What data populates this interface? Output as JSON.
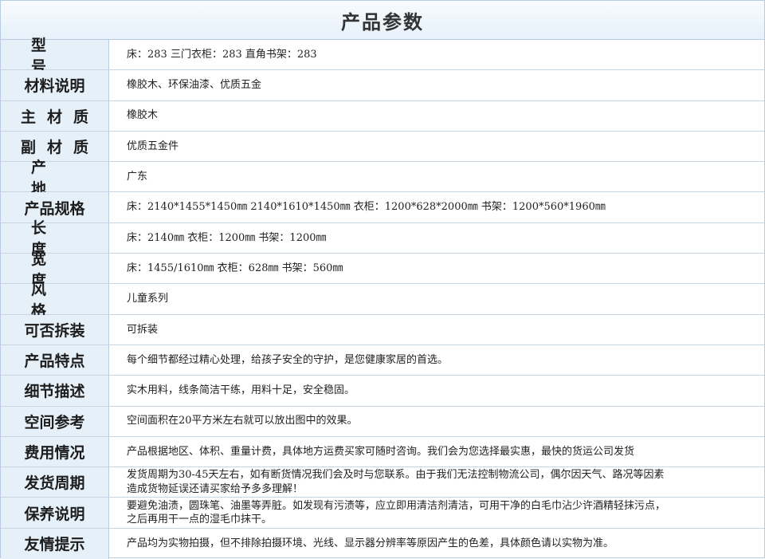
{
  "title": "产品参数",
  "rows": [
    {
      "label": "型 号",
      "value": "床：283  三门衣柜：283  直角书架：283",
      "key": "model"
    },
    {
      "label": "材料说明",
      "value": "橡胶木、环保油漆、优质五金",
      "key": "material-desc"
    },
    {
      "label": "主材质",
      "value": "橡胶木",
      "key": "main-material"
    },
    {
      "label": "副材质",
      "value": "优质五金件",
      "key": "sub-material"
    },
    {
      "label": "产 地",
      "value": "广东",
      "key": "origin"
    },
    {
      "label": "产品规格",
      "value": "床：2140*1455*1450㎜  2140*1610*1450㎜  衣柜：1200*628*2000㎜    书架：1200*560*1960㎜",
      "key": "spec"
    },
    {
      "label": "长 度",
      "value": "床：2140㎜  衣柜：1200㎜   书架：1200㎜",
      "key": "length"
    },
    {
      "label": "宽 度",
      "value": "床：1455/1610㎜  衣柜：628㎜   书架：560㎜",
      "key": "width"
    },
    {
      "label": "风 格",
      "value": "儿童系列",
      "key": "style"
    },
    {
      "label": "可否拆装",
      "value": "可拆装",
      "key": "detachable"
    },
    {
      "label": "产品特点",
      "value": "每个细节都经过精心处理，给孩子安全的守护，是您健康家居的首选。",
      "key": "features"
    },
    {
      "label": "细节描述",
      "value": "实木用料，线条简洁干练，用料十足，安全稳固。",
      "key": "details"
    },
    {
      "label": "空间参考",
      "value": "空间面积在20平方米左右就可以放出图中的效果。",
      "key": "space"
    },
    {
      "label": "费用情况",
      "value": "产品根据地区、体积、重量计费，具体地方运费买家可随时咨询。我们会为您选择最实惠，最快的货运公司发货",
      "key": "cost"
    },
    {
      "label": "发货周期",
      "value": "发货周期为30-45天左右，如有断货情况我们会及时与您联系。由于我们无法控制物流公司，偶尔因天气、路况等因素\n造成货物延误还请买家给予多多理解！",
      "key": "shipping"
    },
    {
      "label": "保养说明",
      "value": "要避免油渍，圆珠笔、油墨等弄脏。如发现有污渍等，应立即用清洁剂清洁，可用干净的白毛巾沾少许酒精轻抹污点，\n之后再用干一点的湿毛巾抹干。",
      "key": "maintenance"
    },
    {
      "label": "友情提示",
      "value": "产品均为实物拍摄，但不排除拍摄环境、光线、显示器分辨率等原因产生的色差，具体颜色请以实物为准。",
      "key": "notice"
    }
  ]
}
